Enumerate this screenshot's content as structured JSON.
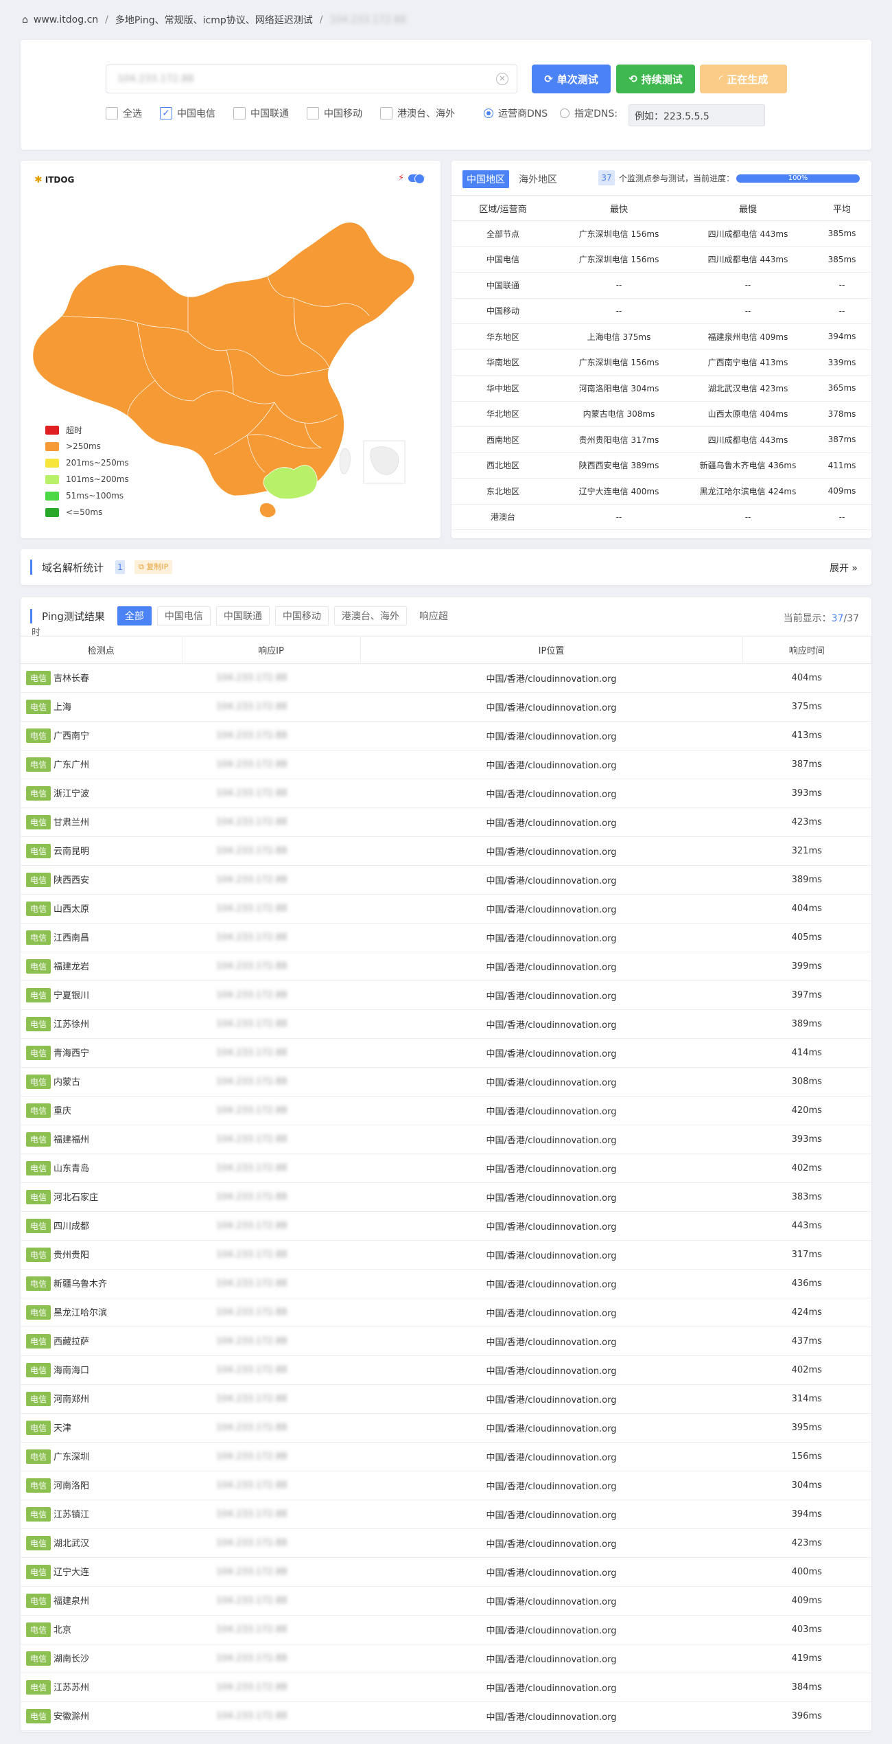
{
  "breadcrumb": {
    "site": "www.itdog.cn",
    "page": "多地Ping、常规版、icmp协议、网络延迟测试",
    "target": "104.233.172.88"
  },
  "search": {
    "value": "104.233.172.88",
    "btn_single": "单次测试",
    "btn_continuous": "持续测试",
    "btn_generating": "正在生成"
  },
  "options": {
    "all": "全选",
    "telecom": "中国电信",
    "unicom": "中国联通",
    "mobile": "中国移动",
    "hk": "港澳台、海外",
    "carrier_dns": "运营商DNS",
    "custom_dns": "指定DNS:",
    "dns_placeholder": "例如：223.5.5.5"
  },
  "map": {
    "logo": "ITDOG",
    "legend": [
      {
        "label": "超时",
        "color": "#e02020"
      },
      {
        "label": ">250ms",
        "color": "#f59a34"
      },
      {
        "label": "201ms~250ms",
        "color": "#f7e53c"
      },
      {
        "label": "101ms~200ms",
        "color": "#b8f06a"
      },
      {
        "label": "51ms~100ms",
        "color": "#4cd945"
      },
      {
        "label": "<=50ms",
        "color": "#2aa82a"
      }
    ]
  },
  "stats": {
    "tab_china": "中国地区",
    "tab_overseas": "海外地区",
    "count": "37",
    "count_text": "个监测点参与测试，当前进度：",
    "progress": "100%",
    "headers": [
      "区域/运营商",
      "最快",
      "最慢",
      "平均"
    ],
    "rows": [
      [
        "全部节点",
        "广东深圳电信 156ms",
        "四川成都电信 443ms",
        "385ms"
      ],
      [
        "中国电信",
        "广东深圳电信 156ms",
        "四川成都电信 443ms",
        "385ms"
      ],
      [
        "中国联通",
        "--",
        "--",
        "--"
      ],
      [
        "中国移动",
        "--",
        "--",
        "--"
      ],
      [
        "华东地区",
        "上海电信 375ms",
        "福建泉州电信 409ms",
        "394ms"
      ],
      [
        "华南地区",
        "广东深圳电信 156ms",
        "广西南宁电信 413ms",
        "339ms"
      ],
      [
        "华中地区",
        "河南洛阳电信 304ms",
        "湖北武汉电信 423ms",
        "365ms"
      ],
      [
        "华北地区",
        "内蒙古电信 308ms",
        "山西太原电信 404ms",
        "378ms"
      ],
      [
        "西南地区",
        "贵州贵阳电信 317ms",
        "四川成都电信 443ms",
        "387ms"
      ],
      [
        "西北地区",
        "陕西西安电信 389ms",
        "新疆乌鲁木齐电信 436ms",
        "411ms"
      ],
      [
        "东北地区",
        "辽宁大连电信 400ms",
        "黑龙江哈尔滨电信 424ms",
        "409ms"
      ],
      [
        "港澳台",
        "--",
        "--",
        "--"
      ]
    ]
  },
  "dns": {
    "title": "域名解析统计",
    "count": "1",
    "copy_ip": "复制IP",
    "expand": "展开"
  },
  "results": {
    "title": "Ping测试结果",
    "tabs": [
      "全部",
      "中国电信",
      "中国联通",
      "中国移动",
      "港澳台、海外",
      "响应超"
    ],
    "tab_tail": "时",
    "current_label": "当前显示：",
    "current": "37",
    "total": "37",
    "headers": [
      "检测点",
      "响应IP",
      "IP位置",
      "响应时间"
    ],
    "isp": "电信",
    "ip": "104.233.172.88",
    "location": "中国/香港/cloudinnovation.org",
    "rows": [
      [
        "吉林长春",
        "404ms"
      ],
      [
        "上海",
        "375ms"
      ],
      [
        "广西南宁",
        "413ms"
      ],
      [
        "广东广州",
        "387ms"
      ],
      [
        "浙江宁波",
        "393ms"
      ],
      [
        "甘肃兰州",
        "423ms"
      ],
      [
        "云南昆明",
        "321ms"
      ],
      [
        "陕西西安",
        "389ms"
      ],
      [
        "山西太原",
        "404ms"
      ],
      [
        "江西南昌",
        "405ms"
      ],
      [
        "福建龙岩",
        "399ms"
      ],
      [
        "宁夏银川",
        "397ms"
      ],
      [
        "江苏徐州",
        "389ms"
      ],
      [
        "青海西宁",
        "414ms"
      ],
      [
        "内蒙古",
        "308ms"
      ],
      [
        "重庆",
        "420ms"
      ],
      [
        "福建福州",
        "393ms"
      ],
      [
        "山东青岛",
        "402ms"
      ],
      [
        "河北石家庄",
        "383ms"
      ],
      [
        "四川成都",
        "443ms"
      ],
      [
        "贵州贵阳",
        "317ms"
      ],
      [
        "新疆乌鲁木齐",
        "436ms"
      ],
      [
        "黑龙江哈尔滨",
        "424ms"
      ],
      [
        "西藏拉萨",
        "437ms"
      ],
      [
        "海南海口",
        "402ms"
      ],
      [
        "河南郑州",
        "314ms"
      ],
      [
        "天津",
        "395ms"
      ],
      [
        "广东深圳",
        "156ms"
      ],
      [
        "河南洛阳",
        "304ms"
      ],
      [
        "江苏镇江",
        "394ms"
      ],
      [
        "湖北武汉",
        "423ms"
      ],
      [
        "辽宁大连",
        "400ms"
      ],
      [
        "福建泉州",
        "409ms"
      ],
      [
        "北京",
        "403ms"
      ],
      [
        "湖南长沙",
        "419ms"
      ],
      [
        "江苏苏州",
        "384ms"
      ],
      [
        "安徽滁州",
        "396ms"
      ]
    ]
  }
}
